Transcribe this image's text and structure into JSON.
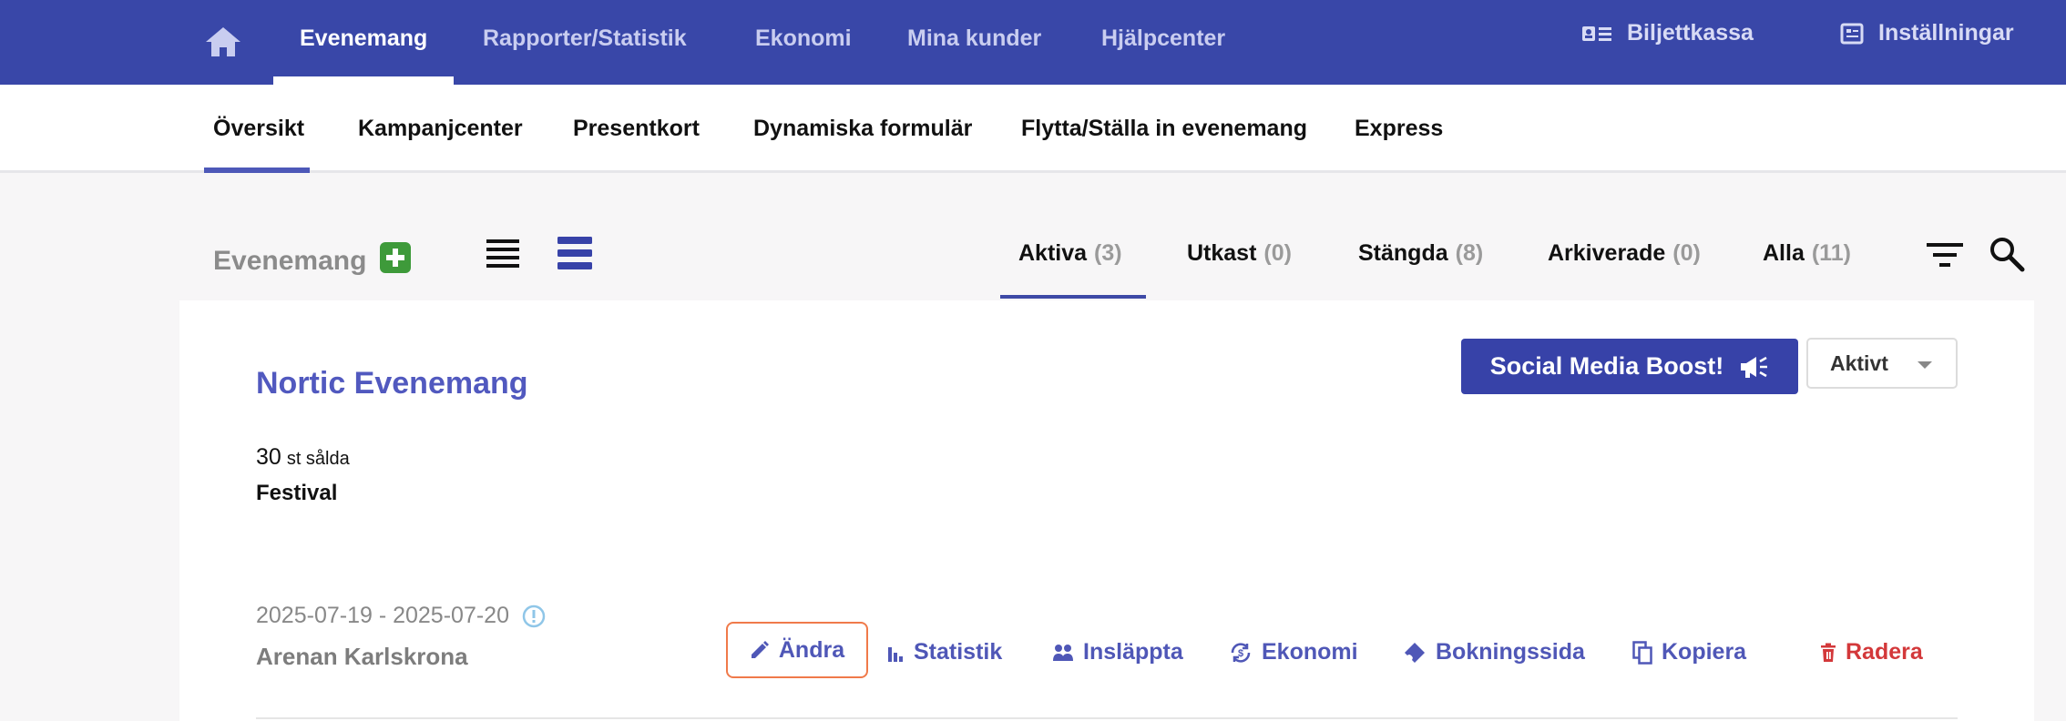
{
  "topnav": {
    "home_icon": "home-icon",
    "items": [
      {
        "label": "Evenemang",
        "active": true
      },
      {
        "label": "Rapporter/Statistik",
        "active": false
      },
      {
        "label": "Ekonomi",
        "active": false
      },
      {
        "label": "Mina kunder",
        "active": false
      },
      {
        "label": "Hjälpcenter",
        "active": false
      }
    ],
    "right": [
      {
        "label": "Biljettkassa",
        "icon": "ticket-office-icon"
      },
      {
        "label": "Inställningar",
        "icon": "settings-icon"
      }
    ]
  },
  "subnav": {
    "items": [
      {
        "label": "Översikt",
        "active": true
      },
      {
        "label": "Kampanjcenter",
        "active": false
      },
      {
        "label": "Presentkort",
        "active": false
      },
      {
        "label": "Dynamiska formulär",
        "active": false
      },
      {
        "label": "Flytta/Ställa in evenemang",
        "active": false
      },
      {
        "label": "Express",
        "active": false
      }
    ]
  },
  "toolbar": {
    "title": "Evenemang",
    "add_icon": "plus-icon",
    "view_icons": [
      "compact-list-icon",
      "expanded-list-icon"
    ],
    "status_tabs": [
      {
        "label": "Aktiva",
        "count": "(3)",
        "active": true
      },
      {
        "label": "Utkast",
        "count": "(0)",
        "active": false
      },
      {
        "label": "Stängda",
        "count": "(8)",
        "active": false
      },
      {
        "label": "Arkiverade",
        "count": "(0)",
        "active": false
      },
      {
        "label": "Alla",
        "count": "(11)",
        "active": false
      }
    ],
    "filter_icon": "filter-icon",
    "search_icon": "search-icon"
  },
  "event": {
    "title": "Nortic Evenemang",
    "sold_count": "30",
    "sold_unit": "st sålda",
    "category": "Festival",
    "dates": "2025-07-19 - 2025-07-20",
    "venue": "Arenan Karlskrona",
    "boost_label": "Social Media Boost!",
    "status_value": "Aktivt",
    "actions": {
      "edit": "Ändra",
      "stats": "Statistik",
      "admitted": "Insläppta",
      "economy": "Ekonomi",
      "booking": "Bokningssida",
      "copy": "Kopiera",
      "delete": "Radera"
    }
  },
  "colors": {
    "topbar": "#3947a8",
    "accent": "#4f57b7",
    "add_green": "#3e9a3a",
    "delete_red": "#d3383a",
    "edit_border": "#f07a4a"
  }
}
